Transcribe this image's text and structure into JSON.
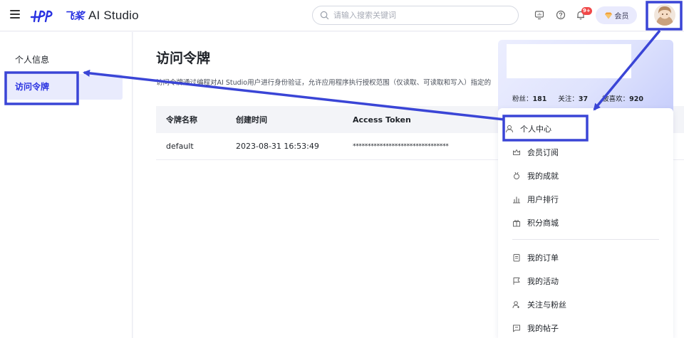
{
  "header": {
    "logo_cn": "飞桨",
    "logo_en": "AI Studio",
    "search_placeholder": "请输入搜索关键词",
    "notification_badge": "9+",
    "vip_label": "会员"
  },
  "sidebar": {
    "items": [
      {
        "label": "个人信息",
        "active": false
      },
      {
        "label": "访问令牌",
        "active": true
      }
    ]
  },
  "main": {
    "title": "访问令牌",
    "description": "访问令牌通过编程对AI Studio用户进行身份验证，允许应用程序执行授权范围（仅读取、可读取和写入）指定的",
    "table": {
      "headers": [
        "令牌名称",
        "创建时间",
        "Access Token"
      ],
      "rows": [
        [
          "default",
          "2023-08-31 16:53:49",
          "********************************"
        ]
      ]
    }
  },
  "profile_panel": {
    "stats": [
      {
        "label": "粉丝：",
        "value": "181"
      },
      {
        "label": "关注：",
        "value": "37"
      },
      {
        "label": "被喜欢：",
        "value": "920"
      }
    ],
    "menu": [
      {
        "label": "个人中心",
        "icon": "user-icon"
      },
      {
        "label": "会员订阅",
        "icon": "crown-icon"
      },
      {
        "label": "我的成就",
        "icon": "medal-icon"
      },
      {
        "label": "用户排行",
        "icon": "bar-chart-icon"
      },
      {
        "label": "积分商城",
        "icon": "gift-icon"
      },
      {
        "label": "我的订单",
        "icon": "order-icon"
      },
      {
        "label": "我的活动",
        "icon": "flag-icon"
      },
      {
        "label": "关注与粉丝",
        "icon": "follow-icon"
      },
      {
        "label": "我的帖子",
        "icon": "post-icon"
      }
    ]
  },
  "colors": {
    "brand": "#2932e1",
    "annotation": "#3a45d6",
    "active_bg": "#e9ebfd",
    "badge": "#f04848"
  }
}
